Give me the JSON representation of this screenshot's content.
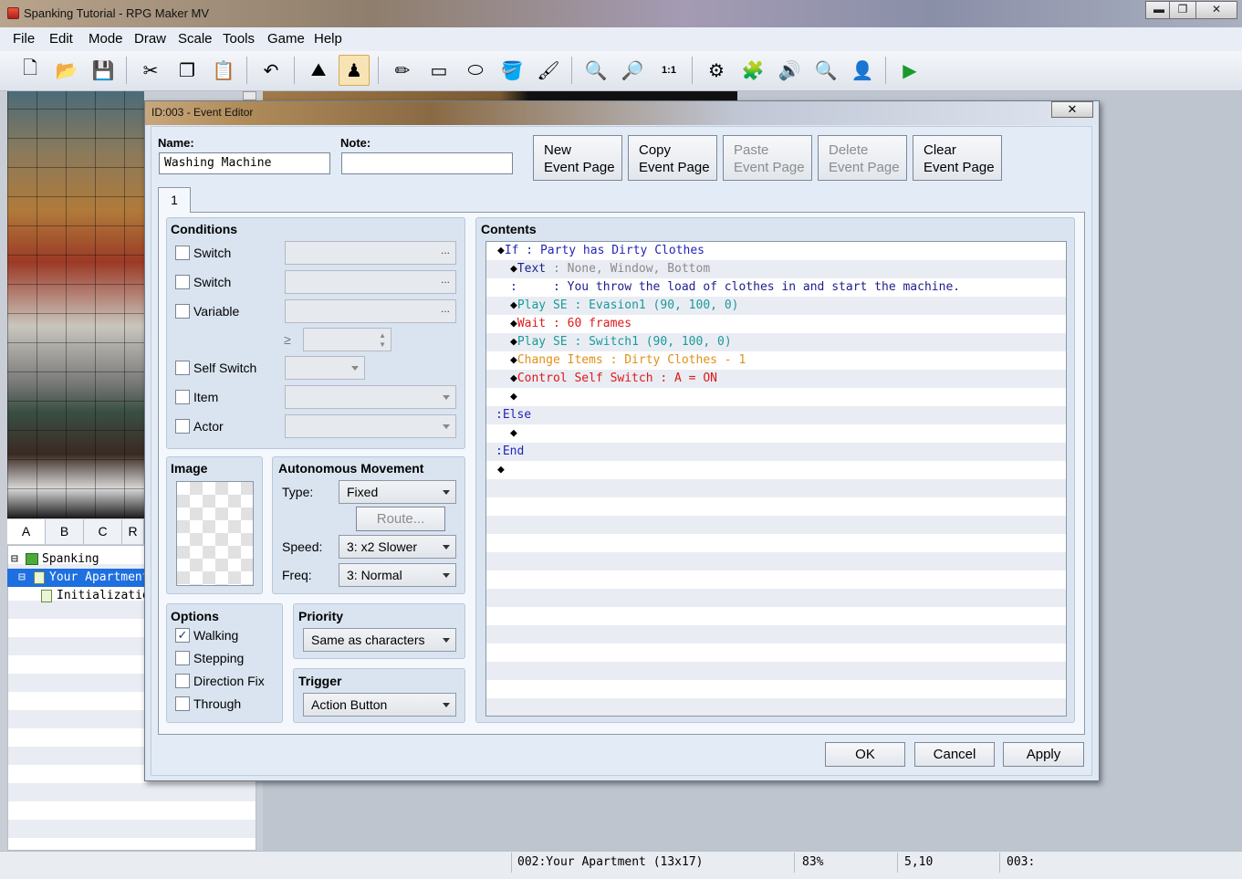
{
  "window": {
    "title": "Spanking Tutorial - RPG Maker MV",
    "minimize": "▬",
    "maximize": "❐",
    "close": "✕"
  },
  "menu": [
    "File",
    "Edit",
    "Mode",
    "Draw",
    "Scale",
    "Tools",
    "Game",
    "Help"
  ],
  "toolbar": [
    {
      "icon": "new-project-icon",
      "glyph": "🗋"
    },
    {
      "icon": "open-project-icon",
      "glyph": "📂"
    },
    {
      "icon": "save-project-icon",
      "glyph": "💾"
    },
    {
      "icon": "cut-icon",
      "glyph": "✂"
    },
    {
      "icon": "copy-icon",
      "glyph": "❐"
    },
    {
      "icon": "paste-icon",
      "glyph": "📋"
    },
    {
      "icon": "undo-icon",
      "glyph": "↶"
    },
    {
      "icon": "map-mode-icon",
      "glyph": "⛰"
    },
    {
      "icon": "event-mode-icon",
      "glyph": "♟"
    },
    {
      "icon": "pencil-icon",
      "glyph": "✏"
    },
    {
      "icon": "rectangle-icon",
      "glyph": "▭"
    },
    {
      "icon": "ellipse-icon",
      "glyph": "⬭"
    },
    {
      "icon": "flood-fill-icon",
      "glyph": "🪣"
    },
    {
      "icon": "shadow-pen-icon",
      "glyph": "🖌"
    },
    {
      "icon": "zoom-in-icon",
      "glyph": "🔍"
    },
    {
      "icon": "zoom-out-icon",
      "glyph": "🔎"
    },
    {
      "icon": "zoom-actual-icon",
      "glyph": "1:1"
    },
    {
      "icon": "database-icon",
      "glyph": "⚙"
    },
    {
      "icon": "plugin-manager-icon",
      "glyph": "🧩"
    },
    {
      "icon": "sound-test-icon",
      "glyph": "🔊"
    },
    {
      "icon": "event-searcher-icon",
      "glyph": "🔍"
    },
    {
      "icon": "character-generator-icon",
      "glyph": "👤"
    },
    {
      "icon": "playtest-icon",
      "glyph": "▶"
    }
  ],
  "tileset_tabs": [
    "A",
    "B",
    "C",
    "R"
  ],
  "map_tree": [
    {
      "label": "Spanking Tutorial",
      "expand": "⊟"
    },
    {
      "label": "Your Apartment",
      "expand": "⊟"
    },
    {
      "label": "Initialization",
      "expand": ""
    }
  ],
  "statusbar": {
    "map": "002:Your Apartment (13x17)",
    "zoom": "83%",
    "coords": "5,10",
    "event": "003:"
  },
  "dialog": {
    "title": "ID:003 - Event Editor",
    "close": "✕",
    "name_label": "Name:",
    "name_value": "Washing Machine",
    "note_label": "Note:",
    "note_value": "",
    "page_buttons": [
      {
        "line1": "New",
        "line2": "Event Page",
        "enabled": true
      },
      {
        "line1": "Copy",
        "line2": "Event Page",
        "enabled": true
      },
      {
        "line1": "Paste",
        "line2": "Event Page",
        "enabled": false
      },
      {
        "line1": "Delete",
        "line2": "Event Page",
        "enabled": false
      },
      {
        "line1": "Clear",
        "line2": "Event Page",
        "enabled": true
      }
    ],
    "tab": "1",
    "conditions": {
      "title": "Conditions",
      "switch1": "Switch",
      "switch2": "Switch",
      "variable": "Variable",
      "gte": "≥",
      "self_switch": "Self Switch",
      "item": "Item",
      "actor": "Actor",
      "dots": "..."
    },
    "image": {
      "title": "Image"
    },
    "movement": {
      "title": "Autonomous Movement",
      "type_label": "Type:",
      "type_value": "Fixed",
      "route": "Route...",
      "speed_label": "Speed:",
      "speed_value": "3: x2 Slower",
      "freq_label": "Freq:",
      "freq_value": "3: Normal"
    },
    "options": {
      "title": "Options",
      "walking": "Walking",
      "walking_checked": "✓",
      "stepping": "Stepping",
      "direction_fix": "Direction Fix",
      "through": "Through"
    },
    "priority": {
      "title": "Priority",
      "value": "Same as characters"
    },
    "trigger": {
      "title": "Trigger",
      "value": "Action Button"
    },
    "contents": {
      "title": "Contents",
      "lines": [
        {
          "d": "◆",
          "parts": [
            {
              "t": "If",
              "c": "c-blue"
            },
            {
              "t": " : ",
              "c": "c-blue"
            },
            {
              "t": "Party has Dirty Clothes",
              "c": "c-blue"
            }
          ]
        },
        {
          "d": "◆",
          "parts": [
            {
              "t": "Text",
              "c": "c-navy"
            },
            {
              "t": " : ",
              "c": "c-gray"
            },
            {
              "t": "None, Window, Bottom",
              "c": "c-gray"
            }
          ]
        },
        {
          "d": ":",
          "parts": [
            {
              "t": "     : ",
              "c": "c-navy"
            },
            {
              "t": "You throw the load of clothes in and start the machine.",
              "c": "c-navy"
            }
          ]
        },
        {
          "d": "◆",
          "parts": [
            {
              "t": "Play SE",
              "c": "c-teal"
            },
            {
              "t": " : ",
              "c": "c-teal"
            },
            {
              "t": "Evasion1 (90, 100, 0)",
              "c": "c-teal"
            }
          ]
        },
        {
          "d": "◆",
          "parts": [
            {
              "t": "Wait",
              "c": "c-red"
            },
            {
              "t": " : ",
              "c": "c-red"
            },
            {
              "t": "60 frames",
              "c": "c-red"
            }
          ]
        },
        {
          "d": "◆",
          "parts": [
            {
              "t": "Play SE",
              "c": "c-teal"
            },
            {
              "t": " : ",
              "c": "c-teal"
            },
            {
              "t": "Switch1 (90, 100, 0)",
              "c": "c-teal"
            }
          ]
        },
        {
          "d": "◆",
          "parts": [
            {
              "t": "Change Items",
              "c": "c-orange"
            },
            {
              "t": " : ",
              "c": "c-orange"
            },
            {
              "t": "Dirty Clothes - 1",
              "c": "c-orange"
            }
          ]
        },
        {
          "d": "◆",
          "parts": [
            {
              "t": "Control Self Switch",
              "c": "c-red"
            },
            {
              "t": " : ",
              "c": "c-red"
            },
            {
              "t": "A = ON",
              "c": "c-red"
            }
          ]
        },
        {
          "d": "◆",
          "parts": []
        },
        {
          "d": ":",
          "parts": [
            {
              "t": "Else",
              "c": "c-blue"
            }
          ]
        },
        {
          "d": "◆",
          "parts": []
        },
        {
          "d": ":",
          "parts": [
            {
              "t": "End",
              "c": "c-blue"
            }
          ]
        },
        {
          "d": "◆",
          "parts": []
        }
      ]
    },
    "ok": "OK",
    "cancel": "Cancel",
    "apply": "Apply"
  }
}
